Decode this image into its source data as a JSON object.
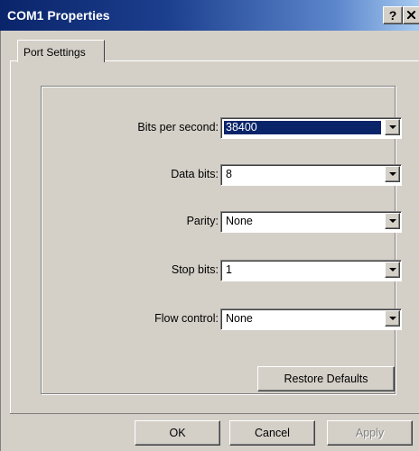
{
  "window": {
    "title": "COM1 Properties",
    "help_label": "?"
  },
  "tabs": [
    {
      "label": "Port Settings"
    }
  ],
  "settings": [
    {
      "label": "Bits per second:",
      "value": "38400",
      "selected": true
    },
    {
      "label": "Data bits:",
      "value": "8"
    },
    {
      "label": "Parity:",
      "value": "None"
    },
    {
      "label": "Stop bits:",
      "value": "1"
    },
    {
      "label": "Flow control:",
      "value": "None"
    }
  ],
  "buttons": {
    "restore_defaults": "Restore Defaults",
    "ok": "OK",
    "cancel": "Cancel",
    "apply": "Apply"
  },
  "icons": [
    "close-icon",
    "chevron-down-icon"
  ],
  "colors": {
    "title_start": "#0a246a",
    "title_end": "#a6caf0",
    "face": "#d4d0c8",
    "highlight": "#0a246a"
  }
}
